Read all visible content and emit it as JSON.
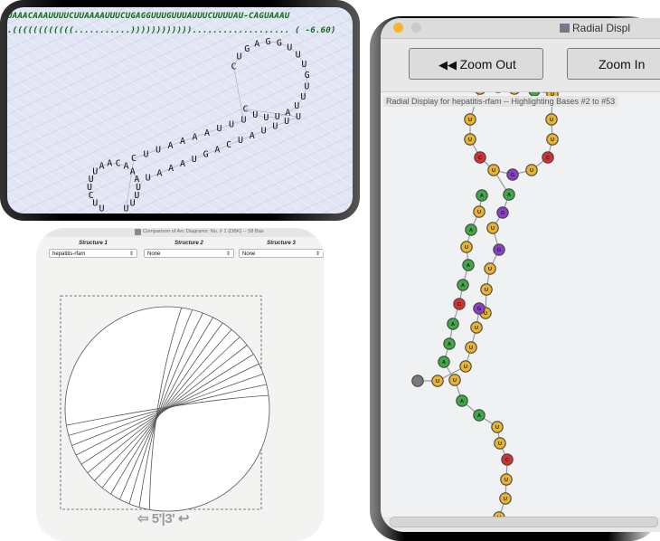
{
  "structure_panel": {
    "sequence": "UAAACAAAUUUUCUUAAAAUUUCUGAGGUUUGUUUAUUUCUUUUAU-CAGUAAAU",
    "dot_bracket": ".((((((((((((...........))))))))))))................... ( -6.60)",
    "bases": [
      "U",
      "U",
      "C",
      "U",
      "U",
      "U",
      "A",
      "A",
      "C",
      "A",
      "A",
      "A",
      "U",
      "U",
      "U",
      "U",
      "C",
      "U",
      "U",
      "A",
      "A",
      "A",
      "A",
      "U",
      "U",
      "U",
      "C",
      "U",
      "G",
      "A",
      "G",
      "G",
      "U",
      "U",
      "U",
      "G",
      "U",
      "U",
      "U",
      "A",
      "U",
      "U",
      "U",
      "C",
      "U",
      "U",
      "U",
      "U",
      "A",
      "U",
      "C",
      "A",
      "G",
      "U",
      "A",
      "A",
      "A",
      "U"
    ]
  },
  "arc_panel": {
    "window_title": "Comparison of Arc Diagrams: No. # 1 (DBK)  --  58 Bas",
    "structure_columns": [
      {
        "label": "Structure 1",
        "selected": "hepatitis-rfam"
      },
      {
        "label": "Structure 2",
        "selected": "None"
      },
      {
        "label": "Structure 3",
        "selected": "None"
      }
    ],
    "end_label": "⇦ 5'|3' ↩"
  },
  "radial_panel": {
    "window_title": "Radial Displ",
    "zoom_out_label": "Zoom Out",
    "zoom_in_label": "Zoom In",
    "caption": "Radial Display for hepatitis-rfam -- Highlighting Bases #2 to #53",
    "colors": {
      "U": "#e8b42c",
      "A": "#3da845",
      "C": "#d43232",
      "G": "#8b3fc8",
      "end": "#7a7a7a"
    }
  }
}
